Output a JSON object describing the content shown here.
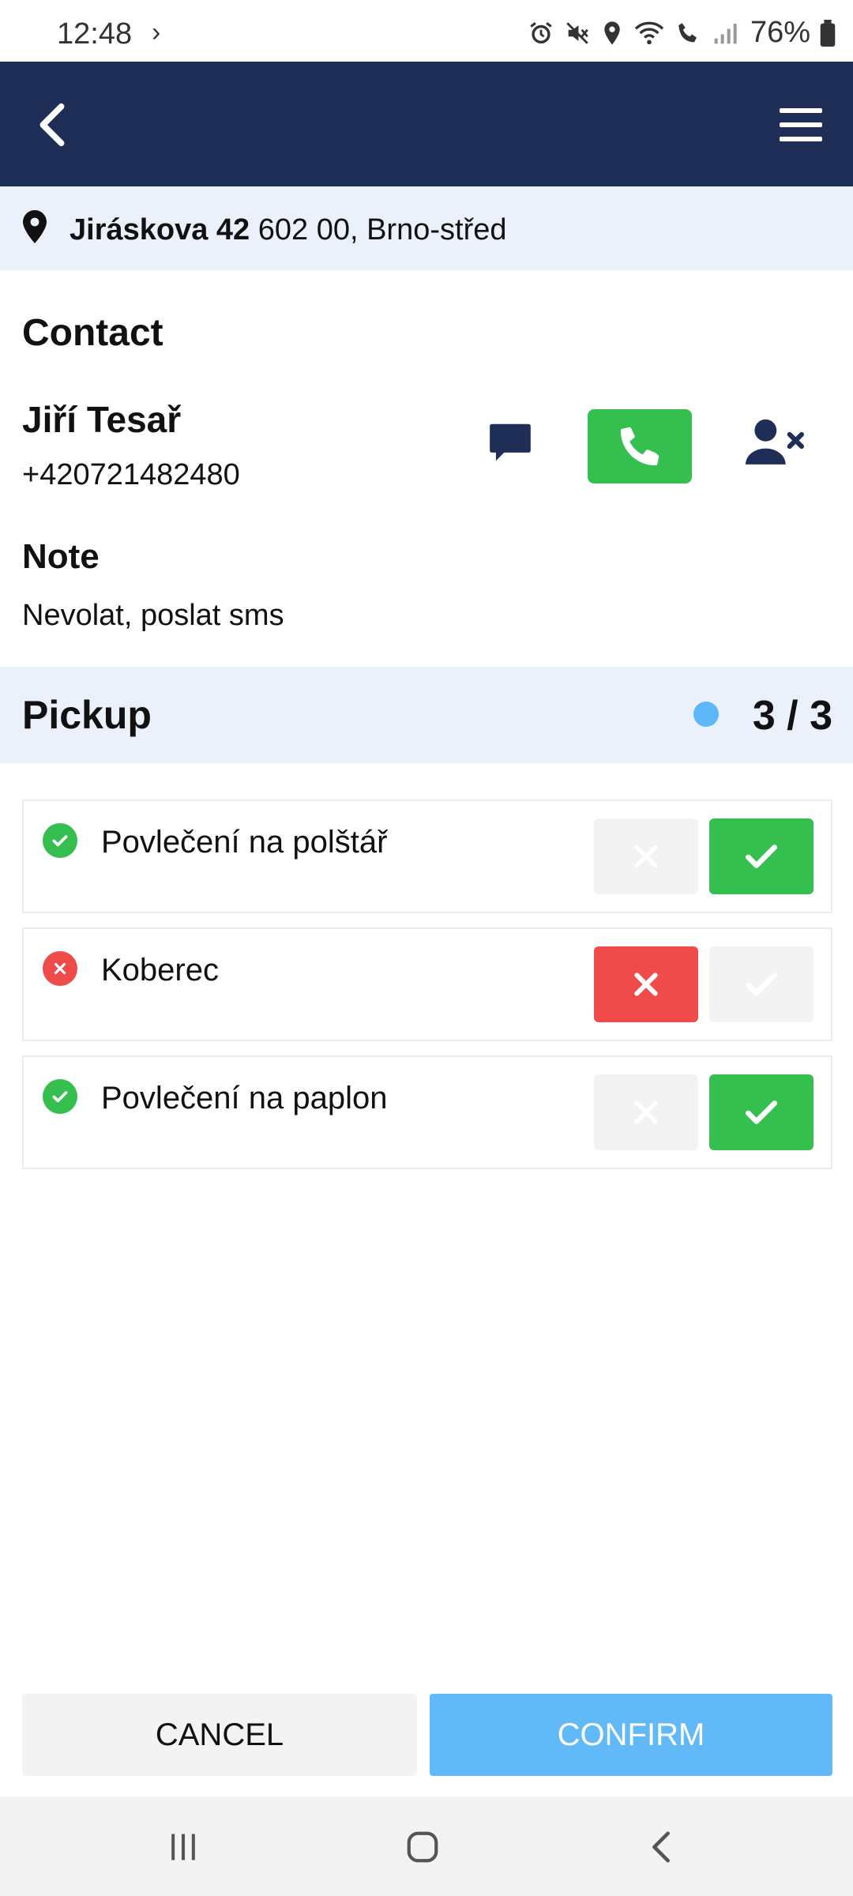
{
  "status_bar": {
    "time": "12:48",
    "chevron": "›",
    "battery": "76%",
    "icons": [
      "alarm-icon",
      "mute-icon",
      "location-icon",
      "wifi-icon",
      "wifi-call-icon",
      "signal-icon",
      "battery-icon"
    ]
  },
  "header": {
    "back_icon": "chevron-left-icon",
    "menu_icon": "hamburger-menu-icon",
    "color": "#1f2e57"
  },
  "address": {
    "street": "Jiráskova 42",
    "city": " 602 00, Brno-střed",
    "icon": "map-pin-icon"
  },
  "contact": {
    "title": "Contact",
    "name": "Jiří Tesař",
    "phone": "+420721482480",
    "note_label": "Note",
    "note": "Nevolat, poslat sms",
    "actions": [
      "sms-icon",
      "phone-icon",
      "remove-user-icon"
    ]
  },
  "pickup": {
    "title": "Pickup",
    "count": "3 / 3",
    "indicator_color": "#5eb8f8",
    "items": [
      {
        "label": "Povlečení na polštář",
        "status": "accepted"
      },
      {
        "label": "Koberec",
        "status": "rejected"
      },
      {
        "label": "Povlečení na paplon",
        "status": "accepted"
      }
    ]
  },
  "footer": {
    "cancel_label": "CANCEL",
    "confirm_label": "CONFIRM"
  },
  "colors": {
    "accept": "#34bf4f",
    "reject": "#f04b4b",
    "inactive": "#f3f3f3",
    "primary": "#62b9f7"
  }
}
